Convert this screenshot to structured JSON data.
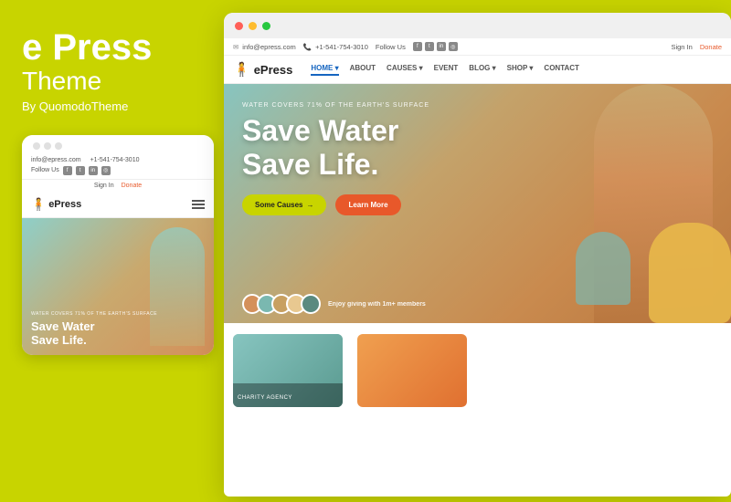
{
  "left": {
    "title_bold": "e Press",
    "title_theme": "Theme",
    "by": "By QuomodoTheme",
    "mobile": {
      "dots": [
        "dot1",
        "dot2",
        "dot3"
      ],
      "email": "info@epress.com",
      "phone": "+1-541-754-3010",
      "follow_us": "Follow Us",
      "sign_in": "Sign In",
      "donate": "Donate",
      "logo": "ePress",
      "hero_subtitle": "WATER COVERS 71% OF THE EARTH'S SURFACE",
      "hero_title_line1": "Save Water",
      "hero_title_line2": "Save Life."
    }
  },
  "desktop": {
    "title_bar_dots": [
      "red",
      "yellow",
      "green"
    ],
    "top_bar": {
      "email": "info@epress.com",
      "phone": "+1-541-754-3010",
      "follow_us": "Follow Us",
      "sign_in": "Sign In",
      "donate": "Donate"
    },
    "nav": {
      "logo": "ePress",
      "items": [
        "HOME",
        "ABOUT",
        "CAUSES",
        "EVENT",
        "BLOG",
        "SHOP",
        "CONTACT"
      ],
      "active": "HOME"
    },
    "hero": {
      "subtitle": "WATER COVERS 71% OF THE EARTH'S SURFACE",
      "title_line1": "Save Water",
      "title_line2": "Save Life.",
      "btn_causes": "Some Causes",
      "btn_learn": "Learn More",
      "members_text": "Enjoy giving with",
      "members_count": "1m+",
      "members_suffix": "members"
    },
    "below": {
      "charity_label": "CHARITY AGENCY"
    }
  }
}
